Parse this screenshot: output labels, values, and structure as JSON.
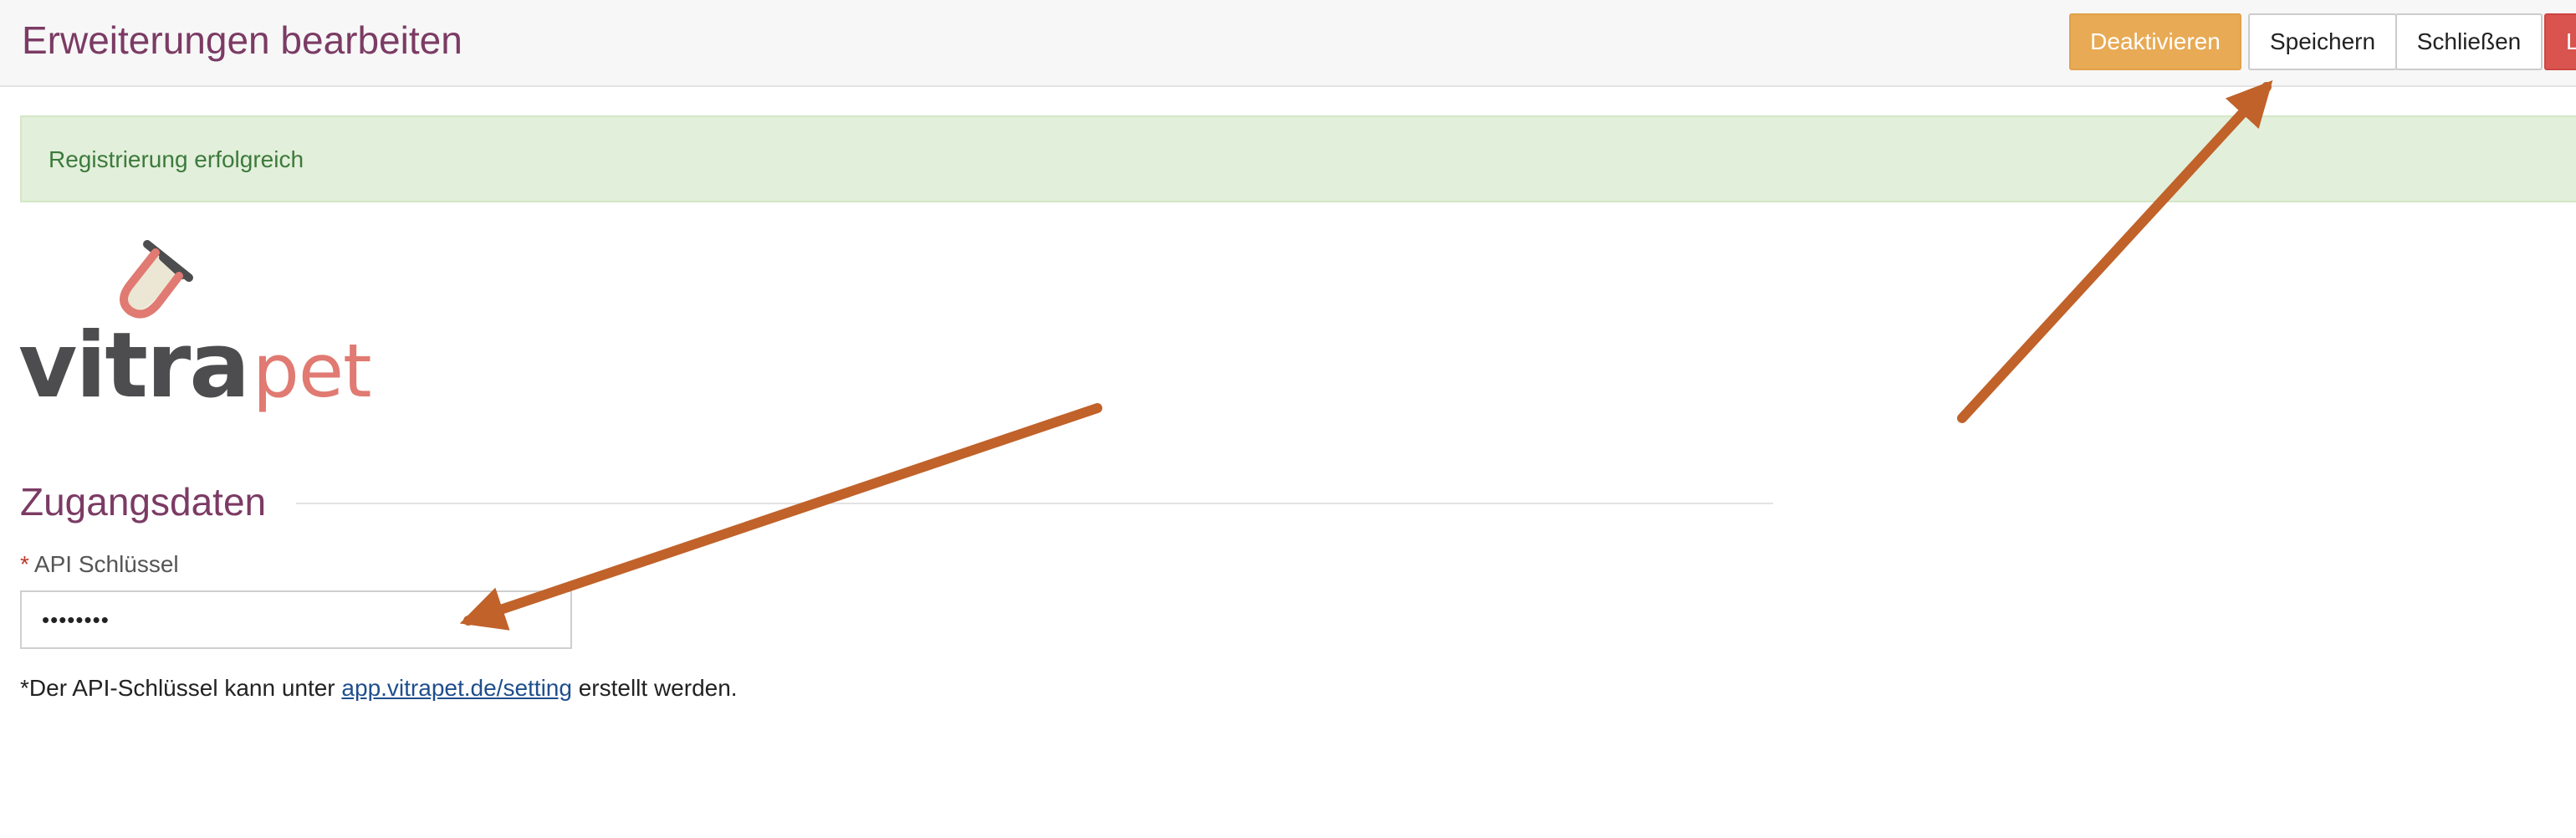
{
  "header": {
    "title": "Erweiterungen bearbeiten",
    "buttons": {
      "deactivate": "Deaktivieren",
      "save": "Speichern",
      "close": "Schließen",
      "delete": "L"
    }
  },
  "alert": {
    "message": "Registrierung erfolgreich"
  },
  "logo": {
    "text_dark": "vitra",
    "text_accent": "pet"
  },
  "section": {
    "title": "Zugangsdaten"
  },
  "form": {
    "api_key": {
      "required_marker": "*",
      "label": "API Schlüssel",
      "value": "••••••••"
    }
  },
  "help": {
    "prefix": "*Der API-Schlüssel kann unter ",
    "link": "app.vitrapet.de/setting",
    "suffix": " erstellt werden."
  },
  "colors": {
    "title": "#7b3b64",
    "deactivate_button": "#e8aa55",
    "delete_button": "#d9534f",
    "alert_background": "#e2efda",
    "alert_text": "#3c7a3c",
    "logo_dark": "#4d4d4f",
    "logo_accent": "#e07a72",
    "annotation_arrow": "#c0622a",
    "link": "#1f4e8c"
  }
}
